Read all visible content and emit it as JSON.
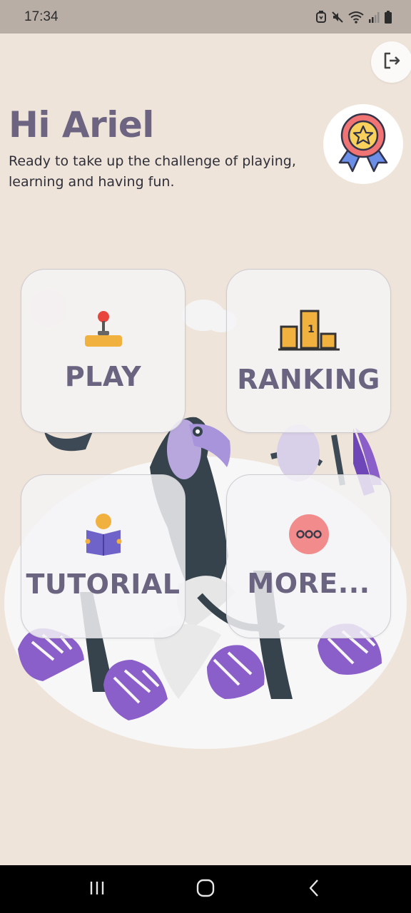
{
  "status_bar": {
    "time": "17:34",
    "icons": [
      "alarm-icon",
      "mute-icon",
      "wifi-icon",
      "signal-icon",
      "battery-icon"
    ]
  },
  "header": {
    "greeting": "Hi Ariel",
    "subtitle": "Ready to take up the challenge of playing, learning and having fun.",
    "logout_icon": "logout-icon",
    "medal_icon": "medal-icon"
  },
  "menu": {
    "items": [
      {
        "label": "PLAY",
        "icon": "joystick-icon"
      },
      {
        "label": "RANKING",
        "icon": "podium-icon"
      },
      {
        "label": "TUTORIAL",
        "icon": "reading-icon"
      },
      {
        "label": "MORE...",
        "icon": "more-icon"
      }
    ]
  },
  "colors": {
    "background": "#efe4da",
    "title": "#6d6481",
    "accent_purple": "#8b5fc9",
    "status_bar": "#b8aea6"
  },
  "nav_bar": {
    "buttons": [
      "recent-apps-icon",
      "home-icon",
      "back-icon"
    ]
  }
}
